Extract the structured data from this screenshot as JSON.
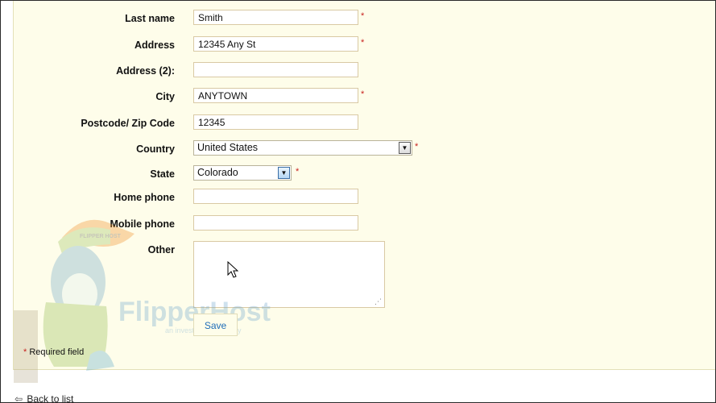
{
  "form": {
    "last_name": {
      "label": "Last name",
      "value": "Smith",
      "required": "*"
    },
    "address": {
      "label": "Address",
      "value": "12345 Any St",
      "required": "*"
    },
    "address2": {
      "label": "Address (2):",
      "value": ""
    },
    "city": {
      "label": "City",
      "value": "ANYTOWN",
      "required": "*"
    },
    "postcode": {
      "label": "Postcode/ Zip Code",
      "value": "12345"
    },
    "country": {
      "label": "Country",
      "value": "United States",
      "required": "*"
    },
    "state": {
      "label": "State",
      "value": "Colorado",
      "required": "*"
    },
    "home_phone": {
      "label": "Home phone",
      "value": ""
    },
    "mobile_phone": {
      "label": "Mobile phone",
      "value": ""
    },
    "other": {
      "label": "Other",
      "value": ""
    },
    "save_label": "Save"
  },
  "footer": {
    "required_star": "*",
    "required_note": "Required field",
    "back_link": "Back to list"
  },
  "watermark": {
    "brand": "FlipperHost",
    "tagline": "an invest host company",
    "cap_text": "FLIPPER HOST"
  },
  "colors": {
    "panel_bg": "#fefdea",
    "required": "#c8211e",
    "link": "#1f6db8"
  }
}
